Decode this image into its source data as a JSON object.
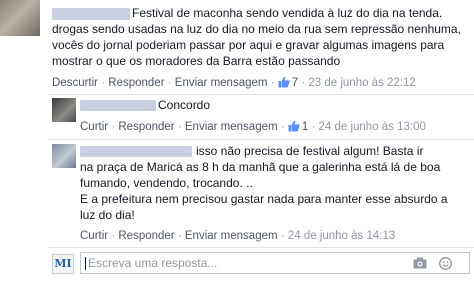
{
  "comment": {
    "text_lines": [
      "Festival de maconha sendo vendida à luz do dia na tenda.",
      "drogas sendo usadas na luz do dia no meio da rua sem repressão nenhuma,",
      "vocês do jornal poderiam passar por aqui e gravar algumas imagens para",
      "mostrar o que os moradores da Barra estão passando"
    ],
    "actions": {
      "discurtir": "Descurtir",
      "responder": "Responder",
      "enviar": "Enviar mensagem",
      "likes": "7",
      "time": "23 de junho às 22:12"
    }
  },
  "replies": [
    {
      "text_lines": [
        "Concordo"
      ],
      "actions": {
        "curtir": "Curtir",
        "responder": "Responder",
        "enviar": "Enviar mensagem",
        "likes": "1",
        "time": "24 de junho às 13:00"
      }
    },
    {
      "text_lines": [
        "isso não precisa de festival algum! Basta ir",
        "na praça de Maricá as 8 h da manhã que a galerinha está lá de boa",
        "fumando, vendendo, trocando. ..",
        "E a prefeitura nem precisou gastar nada para manter esse absurdo a",
        "luz do dia!"
      ],
      "actions": {
        "curtir": "Curtir",
        "responder": "Responder",
        "enviar": "Enviar mensagem",
        "time": "24 de junho às 14:13"
      }
    }
  ],
  "reply_input": {
    "placeholder": "Escreva uma resposta...",
    "avatar_text": "MI"
  },
  "colors": {
    "link": "#4e5665",
    "meta": "#9197a3",
    "like_blue": "#5890ff",
    "divider": "#e1e2e3"
  },
  "icons": [
    "thumbs-up-icon",
    "camera-icon",
    "emoji-icon"
  ]
}
